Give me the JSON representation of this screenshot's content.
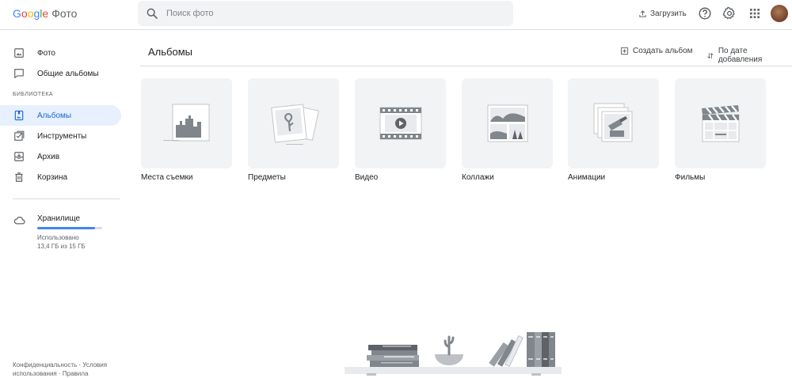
{
  "header": {
    "logo_google": [
      "G",
      "o",
      "o",
      "g",
      "l",
      "e"
    ],
    "logo_product": "Фото",
    "search_placeholder": "Поиск фото",
    "upload_label": "Загрузить",
    "icons": [
      "search-icon",
      "upload-icon",
      "help-icon",
      "settings-icon",
      "apps-grid-icon"
    ]
  },
  "sidebar": {
    "items": [
      {
        "label": "Фото",
        "icon": "photo-icon"
      },
      {
        "label": "Общие альбомы",
        "icon": "shared-albums-icon"
      }
    ],
    "library_label": "БИБЛИОТЕКА",
    "library_items": [
      {
        "label": "Альбомы",
        "icon": "album-icon",
        "active": true
      },
      {
        "label": "Инструменты",
        "icon": "utilities-icon"
      },
      {
        "label": "Архив",
        "icon": "archive-icon"
      },
      {
        "label": "Корзина",
        "icon": "trash-icon"
      }
    ],
    "storage": {
      "title": "Хранилище",
      "used_label": "Использовано",
      "used_text": "13,4 ГБ из 15 ГБ",
      "used_fraction": 0.893
    },
    "footer": {
      "privacy": "Конфиденциальность",
      "sep": "·",
      "terms": "Условия использования",
      "policies": "Правила"
    }
  },
  "main": {
    "title": "Альбомы",
    "create_album_label": "Создать альбом",
    "sort_label": "По дате добавления",
    "albums": [
      {
        "label": "Места съемки",
        "icon": "places-icon"
      },
      {
        "label": "Предметы",
        "icon": "things-icon"
      },
      {
        "label": "Видео",
        "icon": "video-icon"
      },
      {
        "label": "Коллажи",
        "icon": "collage-icon"
      },
      {
        "label": "Анимации",
        "icon": "animation-icon"
      },
      {
        "label": "Фильмы",
        "icon": "movies-icon"
      }
    ]
  },
  "colors": {
    "accent": "#1967d2",
    "active_bg": "#e8f0fe",
    "storage_fill": "#4285f4",
    "card_bg": "#f1f3f4"
  }
}
